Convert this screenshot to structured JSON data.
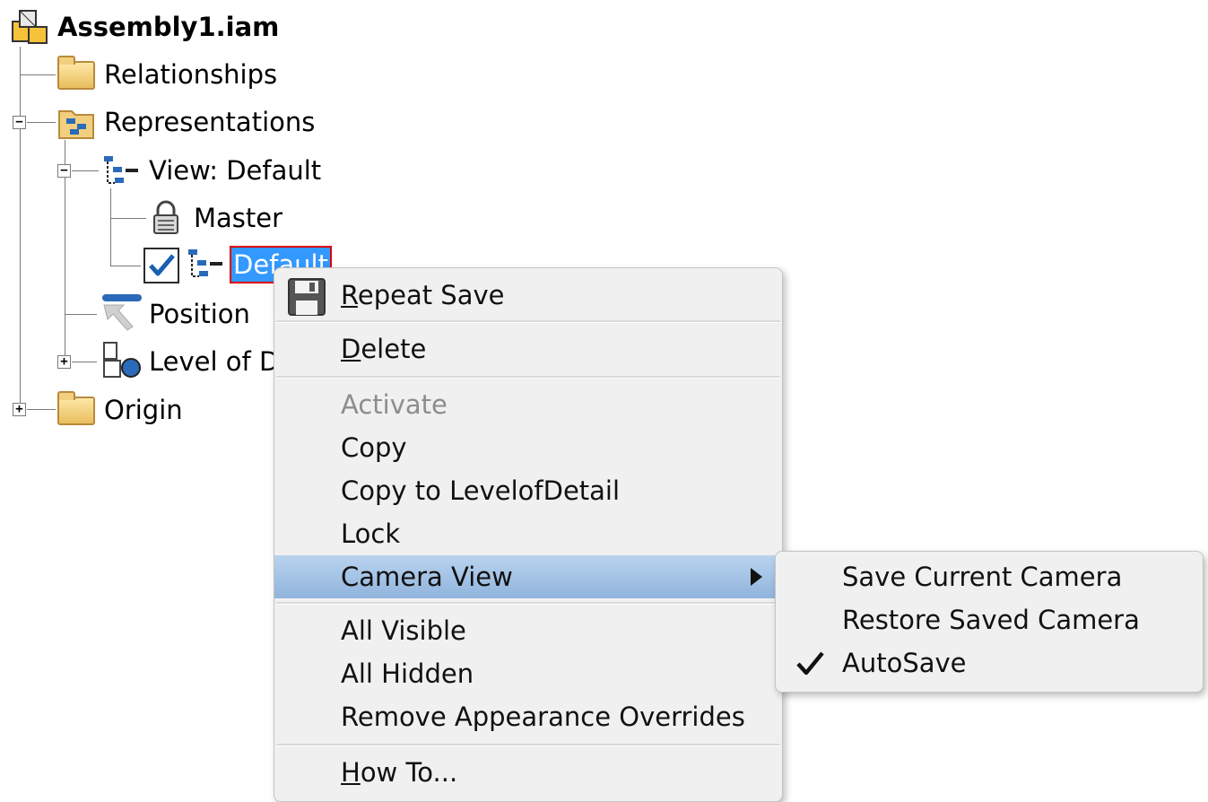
{
  "tree": {
    "root": {
      "label": "Assembly1.iam"
    },
    "nodes": [
      {
        "label": "Relationships",
        "icon": "folder-icon"
      },
      {
        "label": "Representations",
        "icon": "representations-icon",
        "expander": "−"
      },
      {
        "label": "View: Default",
        "icon": "view-rep-icon",
        "expander": "−"
      },
      {
        "label": "Master",
        "icon": "lock-icon"
      },
      {
        "label": "Default",
        "icon": "view-rep-icon",
        "checked": true
      },
      {
        "label": "Position",
        "icon": "position-icon"
      },
      {
        "label": "Level of Detail: Master",
        "label_visible": "Level of D",
        "icon": "level-of-detail-icon",
        "expander": "+"
      },
      {
        "label": "Origin",
        "icon": "folder-icon",
        "expander": "+"
      }
    ]
  },
  "context_menu": {
    "items": [
      {
        "label_u": "R",
        "label_rest": "epeat Save",
        "icon": "save-icon"
      },
      {
        "label_u": "D",
        "label_rest": "elete"
      },
      {
        "label": "Activate",
        "disabled": true
      },
      {
        "label": "Copy"
      },
      {
        "label": "Copy to LevelofDetail"
      },
      {
        "label": "Lock"
      },
      {
        "label": "Camera View",
        "highlighted": true,
        "submenu": true
      },
      {
        "label": "All Visible"
      },
      {
        "label": "All Hidden"
      },
      {
        "label": "Remove Appearance Overrides"
      },
      {
        "label_u": "H",
        "label_rest": "ow To..."
      }
    ]
  },
  "submenu": {
    "items": [
      {
        "label": "Save Current Camera"
      },
      {
        "label": "Restore Saved Camera"
      },
      {
        "label": "AutoSave",
        "checked": true
      }
    ]
  },
  "colors": {
    "selection": "#3399ff",
    "selection_outline": "#e00000",
    "menu_highlight": "#a6c4e6"
  }
}
